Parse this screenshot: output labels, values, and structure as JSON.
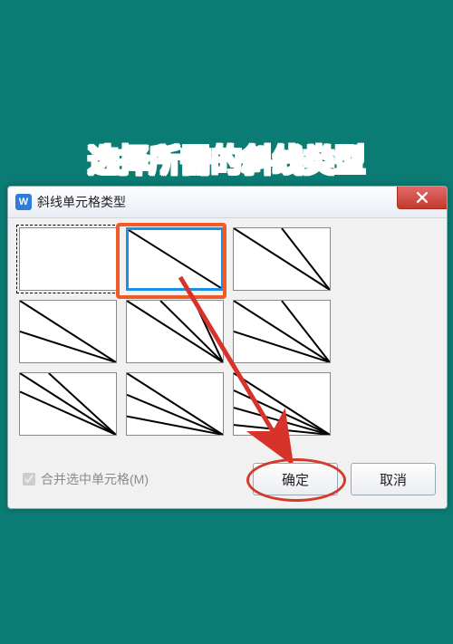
{
  "caption": "选择所需的斜线类型",
  "dialog": {
    "title": "斜线单元格类型",
    "close_icon_name": "close-icon"
  },
  "checkbox": {
    "label": "合并选中单元格(M)",
    "checked": true,
    "disabled": true
  },
  "buttons": {
    "ok": "确定",
    "cancel": "取消"
  },
  "options": [
    {
      "id": "blank",
      "selected_dotted": true,
      "selected_blue": false,
      "lines": []
    },
    {
      "id": "diag1",
      "selected_dotted": false,
      "selected_blue": true,
      "lines": [
        [
          0,
          0,
          100,
          100
        ]
      ]
    },
    {
      "id": "two-a",
      "selected_dotted": false,
      "selected_blue": false,
      "lines": [
        [
          0,
          0,
          100,
          100
        ],
        [
          50,
          0,
          100,
          100
        ]
      ]
    },
    {
      "id": "two-b",
      "selected_dotted": false,
      "selected_blue": false,
      "lines": [
        [
          0,
          0,
          100,
          100
        ],
        [
          0,
          50,
          100,
          100
        ]
      ]
    },
    {
      "id": "three-a",
      "selected_dotted": false,
      "selected_blue": false,
      "lines": [
        [
          0,
          0,
          100,
          100
        ],
        [
          35,
          0,
          100,
          100
        ],
        [
          70,
          0,
          100,
          100
        ]
      ]
    },
    {
      "id": "three-b",
      "selected_dotted": false,
      "selected_blue": false,
      "lines": [
        [
          0,
          0,
          100,
          100
        ],
        [
          50,
          0,
          100,
          100
        ],
        [
          0,
          50,
          100,
          100
        ]
      ]
    },
    {
      "id": "three-c",
      "selected_dotted": false,
      "selected_blue": false,
      "lines": [
        [
          0,
          0,
          100,
          100
        ],
        [
          30,
          0,
          100,
          100
        ],
        [
          0,
          30,
          100,
          100
        ]
      ]
    },
    {
      "id": "three-d",
      "selected_dotted": false,
      "selected_blue": false,
      "lines": [
        [
          0,
          0,
          100,
          100
        ],
        [
          0,
          35,
          100,
          100
        ],
        [
          0,
          70,
          100,
          100
        ]
      ]
    },
    {
      "id": "four-a",
      "selected_dotted": false,
      "selected_blue": false,
      "lines": [
        [
          0,
          0,
          100,
          100
        ],
        [
          0,
          28,
          100,
          100
        ],
        [
          0,
          56,
          100,
          100
        ],
        [
          0,
          84,
          100,
          100
        ]
      ]
    }
  ]
}
